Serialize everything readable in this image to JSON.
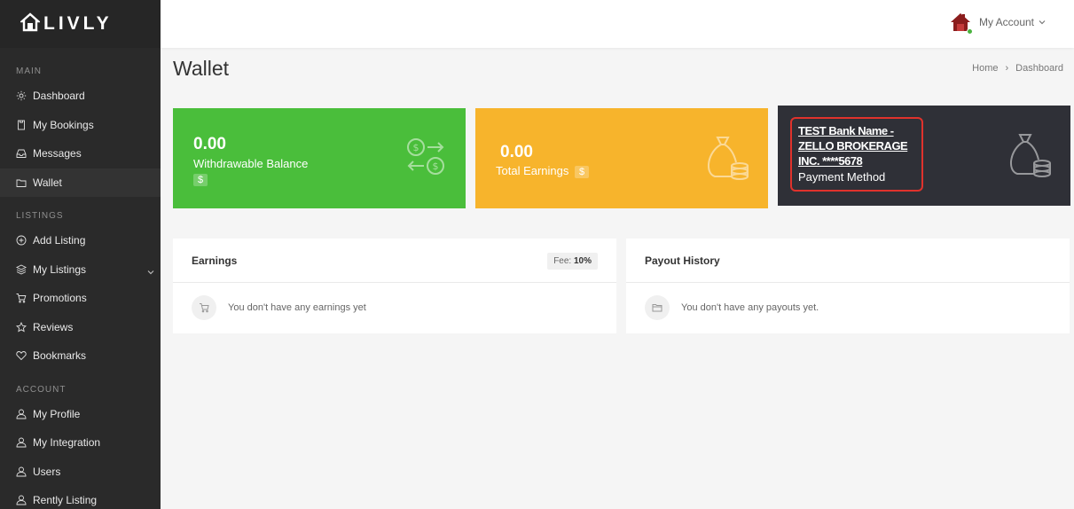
{
  "brand": {
    "name": "LIVLY"
  },
  "sidebar": {
    "sections": [
      {
        "title": "Main",
        "items": [
          {
            "label": "Dashboard",
            "icon": "gear-icon"
          },
          {
            "label": "My Bookings",
            "icon": "bookings-icon"
          },
          {
            "label": "Messages",
            "icon": "inbox-icon"
          },
          {
            "label": "Wallet",
            "icon": "wallet-icon",
            "active": true
          }
        ]
      },
      {
        "title": "Listings",
        "items": [
          {
            "label": "Add Listing",
            "icon": "plus-circle-icon"
          },
          {
            "label": "My Listings",
            "icon": "layers-icon",
            "has_dropdown": true
          },
          {
            "label": "Promotions",
            "icon": "cart-icon"
          },
          {
            "label": "Reviews",
            "icon": "star-icon"
          },
          {
            "label": "Bookmarks",
            "icon": "heart-icon"
          }
        ]
      },
      {
        "title": "Account",
        "items": [
          {
            "label": "My Profile",
            "icon": "user-icon"
          },
          {
            "label": "My Integration",
            "icon": "user-icon"
          },
          {
            "label": "Users",
            "icon": "user-icon"
          },
          {
            "label": "Rently Listing",
            "icon": "user-icon"
          }
        ]
      }
    ]
  },
  "header": {
    "account_label": "My Account"
  },
  "page": {
    "title": "Wallet",
    "breadcrumb": [
      "Home",
      "Dashboard"
    ],
    "breadcrumb_separator": "›"
  },
  "cards": {
    "withdrawable": {
      "value": "0.00",
      "label": "Withdrawable Balance",
      "badge": "$",
      "color": "#4abe3b"
    },
    "earnings": {
      "value": "0.00",
      "label": "Total Earnings",
      "badge": "$",
      "color": "#f7b42c"
    },
    "payment": {
      "bank": "TEST Bank Name - ZELLO BROKERAGE INC. ****5678",
      "label": "Payment Method",
      "color": "#2f3037",
      "highlight_color": "#e0322c"
    }
  },
  "earnings_panel": {
    "title": "Earnings",
    "fee_label": "Fee:",
    "fee_value": "10%",
    "empty_text": "You don't have any earnings yet"
  },
  "payouts_panel": {
    "title": "Payout History",
    "empty_text": "You don't have any payouts yet."
  }
}
